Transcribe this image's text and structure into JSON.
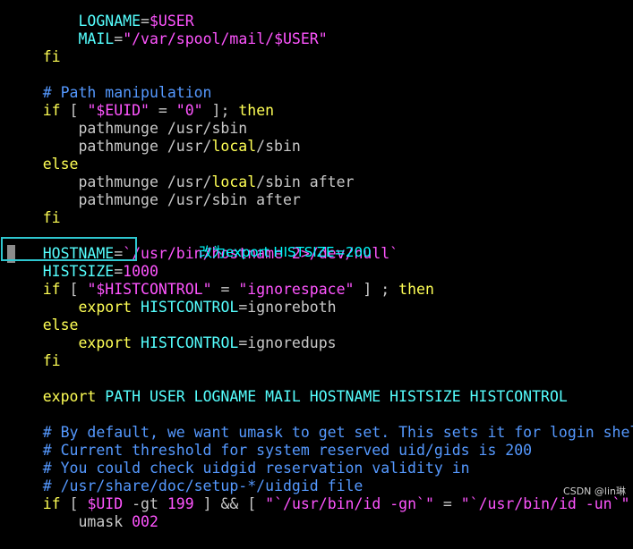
{
  "colors": {
    "background": "#000000",
    "keyword": "#ffff55",
    "string": "#ff55ff",
    "variable": "#55ffff",
    "comment": "#5599ff",
    "text": "#c8c8c8",
    "annotation": "#00ffff"
  },
  "code": {
    "l00": {
      "a": "    ",
      "b": "LOGNAME",
      "c": "=",
      "d": "$USER"
    },
    "l01": {
      "a": "    ",
      "b": "MAIL",
      "c": "=",
      "d": "\"/var/spool/mail/$USER\""
    },
    "l02": {
      "a": "fi"
    },
    "l04": {
      "a": "# Path manipulation"
    },
    "l05": {
      "a": "if",
      "b": " [ ",
      "c": "\"$EUID\"",
      "d": " = ",
      "e": "\"0\"",
      "f": " ]; ",
      "g": "then"
    },
    "l06": {
      "a": "    pathmunge /usr/sbin"
    },
    "l07": {
      "a": "    pathmunge /usr/",
      "b": "local",
      "c": "/sbin"
    },
    "l08": {
      "a": "else"
    },
    "l09": {
      "a": "    pathmunge /usr/",
      "b": "local",
      "c": "/sbin after"
    },
    "l10": {
      "a": "    pathmunge /usr/sbin after"
    },
    "l11": {
      "a": "fi"
    },
    "l13": {
      "a": "HOSTNAME",
      "b": "=",
      "c": "`/usr/bin/hostname 2>/dev/null`"
    },
    "l14": {
      "a": "HISTSIZE",
      "b": "=",
      "c": "1000"
    },
    "l15": {
      "a": "if",
      "b": " [ ",
      "c": "\"$HISTCONTROL\"",
      "d": " = ",
      "e": "\"ignorespace\"",
      "f": " ] ; ",
      "g": "then"
    },
    "l16": {
      "a": "    ",
      "b": "export",
      "c": " ",
      "d": "HISTCONTROL",
      "e": "=ignoreboth"
    },
    "l17": {
      "a": "else"
    },
    "l18": {
      "a": "    ",
      "b": "export",
      "c": " ",
      "d": "HISTCONTROL",
      "e": "=ignoredups"
    },
    "l19": {
      "a": "fi"
    },
    "l21": {
      "a": "export",
      "b": " PATH USER LOGNAME MAIL HOSTNAME HISTSIZE HISTCONTROL"
    },
    "l23": {
      "a": "# By default, we want umask to get set. This sets it for login shell"
    },
    "l24": {
      "a": "# Current threshold for system reserved uid/gids is 200"
    },
    "l25": {
      "a": "# You could check uidgid reservation validity in"
    },
    "l26": {
      "a": "# /usr/share/doc/setup-*/uidgid file"
    },
    "l27": {
      "a": "if",
      "b": " [ ",
      "c": "$UID",
      "d": " -gt ",
      "e": "199",
      "f": " ] && [ ",
      "g": "\"`/usr/bin/id -gn`\"",
      "h": " = ",
      "i": "\"`/usr/bin/id -un`\"",
      "j": " ];"
    },
    "l28": {
      "a": "    umask ",
      "b": "002"
    }
  },
  "annotation": {
    "text": "改为export HISTSIZE=200"
  },
  "watermark": {
    "text": "CSDN @lin琳"
  }
}
